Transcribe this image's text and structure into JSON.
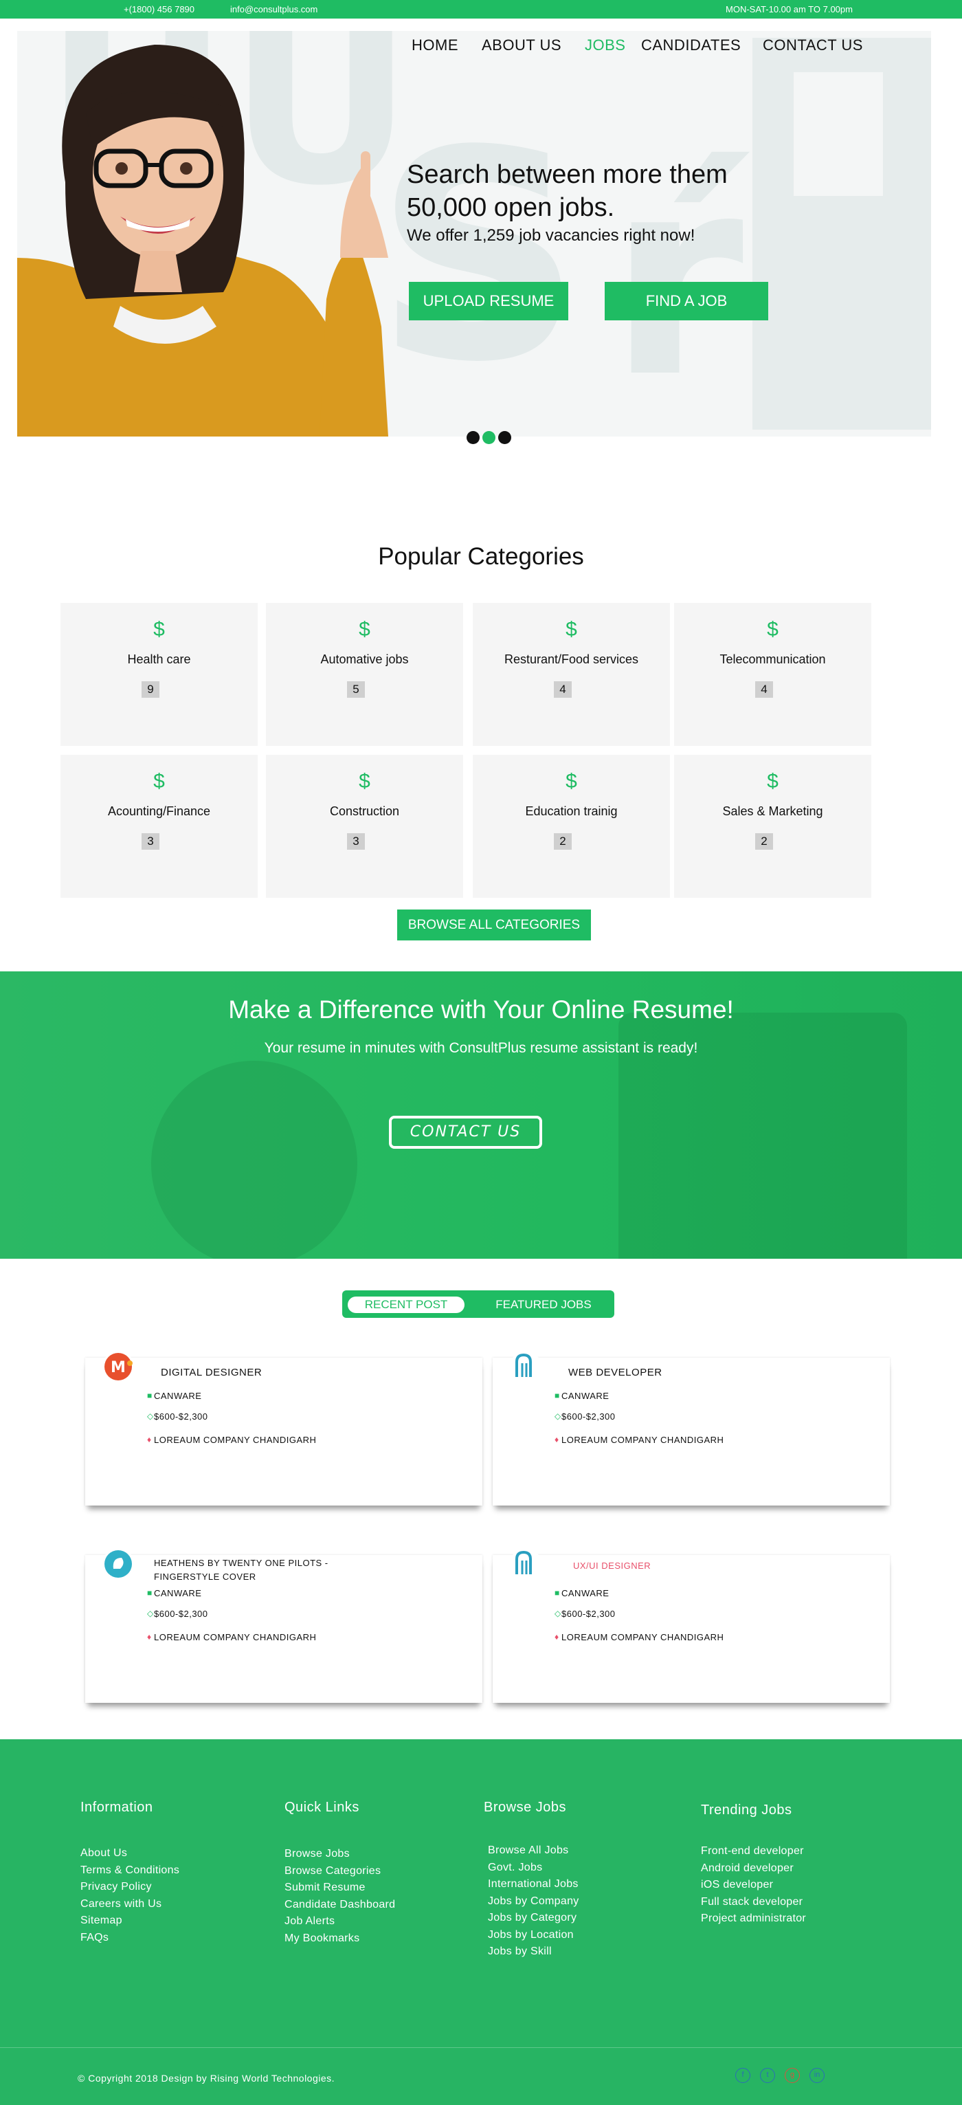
{
  "topbar": {
    "phone": "+(1800) 456 7890",
    "email": "info@consultplus.com",
    "hours": "MON-SAT-10.00 am TO 7.00pm"
  },
  "nav": [
    "HOME",
    "ABOUT US",
    "JOBS",
    "CANDIDATES",
    "CONTACT US"
  ],
  "nav_active": "JOBS",
  "hero": {
    "title_line1": "Search between more them",
    "title_line2": "50,000 open jobs.",
    "subtitle": "We offer 1,259 job vacancies right now!",
    "upload_label": "UPLOAD RESUME",
    "find_label": "FIND A JOB"
  },
  "categories": {
    "title": "Popular Categories",
    "icon": "dollar-icon",
    "items": [
      {
        "name": "Health care",
        "count": "9"
      },
      {
        "name": "Automative jobs",
        "count": "5"
      },
      {
        "name": "Resturant/Food services",
        "count": "4"
      },
      {
        "name": "Telecommunication",
        "count": "4"
      },
      {
        "name": "Acounting/Finance",
        "count": "3"
      },
      {
        "name": "Construction",
        "count": "3"
      },
      {
        "name": "Education trainig",
        "count": "2"
      },
      {
        "name": "Sales & Marketing",
        "count": "2"
      }
    ],
    "browse_label": "BROWSE ALL CATEGORIES"
  },
  "banner": {
    "title": "Make a Difference with Your Online Resume!",
    "subtitle": "Your resume in minutes with ConsultPlus resume assistant is ready!",
    "button": "CONTACT US"
  },
  "tabs": {
    "recent": "RECENT POST",
    "featured": "FEATURED JOBS"
  },
  "jobs": [
    {
      "title": "DIGITAL DESIGNER",
      "company": "CANWARE",
      "salary": "$600-$2,300",
      "location": "LOREAUM COMPANY CHANDIGARH"
    },
    {
      "title": "WEB DEVELOPER",
      "company": "CANWARE",
      "salary": "$600-$2,300",
      "location": "LOREAUM COMPANY CHANDIGARH"
    },
    {
      "title": "HEATHENS BY TWENTY ONE PILOTS - FINGERSTYLE COVER",
      "company": "CANWARE",
      "salary": "$600-$2,300",
      "location": "LOREAUM COMPANY CHANDIGARH"
    },
    {
      "title": "UX/UI DESIGNER",
      "company": "CANWARE",
      "salary": "$600-$2,300",
      "location": "LOREAUM COMPANY CHANDIGARH"
    }
  ],
  "footer": {
    "information": {
      "heading": "Information",
      "links": [
        "About Us",
        "Terms & Conditions",
        "Privacy Policy",
        "Careers with Us",
        "Sitemap",
        "FAQs"
      ]
    },
    "quick": {
      "heading": "Quick Links",
      "links": [
        "Browse Jobs",
        "Browse Categories",
        "Submit Resume",
        "Candidate Dashboard",
        "Job Alerts",
        "My Bookmarks"
      ]
    },
    "browse": {
      "heading": "Browse Jobs",
      "links": [
        "Browse All Jobs",
        "Govt. Jobs",
        "International Jobs",
        "Jobs by Company",
        "Jobs by Category",
        "Jobs by Location",
        "Jobs by Skill"
      ]
    },
    "trending": {
      "heading": "Trending Jobs",
      "links": [
        "Front-end developer",
        "Android developer",
        "iOS developer",
        "Full stack developer",
        "Project administrator"
      ]
    },
    "copyright": "© Copyright 2018 Design by Rising World Technologies.",
    "social": [
      "facebook-icon",
      "twitter-icon",
      "google-plus-icon",
      "linkedin-icon"
    ]
  },
  "colors": {
    "accent": "#1fbc63",
    "footer": "#27b463",
    "ux_title": "#e8506a"
  }
}
